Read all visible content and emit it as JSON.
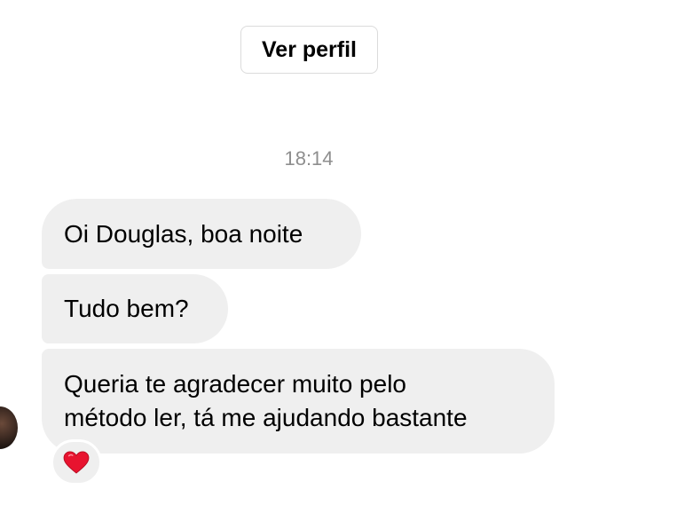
{
  "header": {
    "view_profile_label": "Ver perfil"
  },
  "thread": {
    "timestamp": "18:14",
    "messages": [
      {
        "text": "Oi Douglas, boa noite"
      },
      {
        "text": "Tudo bem?"
      },
      {
        "lines": [
          "Queria te agradecer muito pelo",
          "método ler, tá me ajudando bastante"
        ]
      }
    ],
    "reaction": {
      "icon": "heart-icon",
      "color": "#e8132f"
    }
  },
  "colors": {
    "bubble_bg": "#efefef",
    "timestamp": "#8e8e8e",
    "border": "#dbdbdb"
  }
}
